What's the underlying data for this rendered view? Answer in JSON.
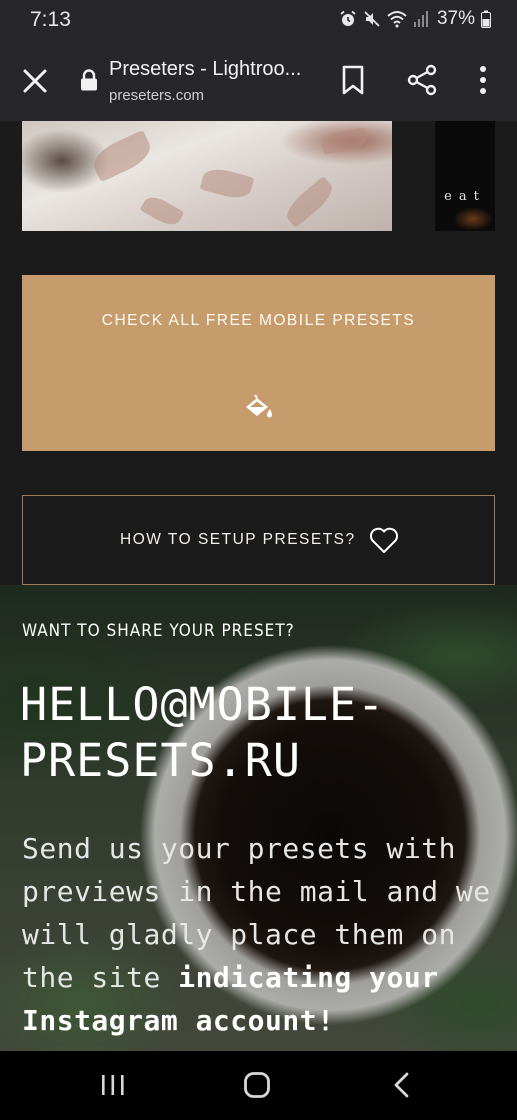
{
  "status_bar": {
    "time": "7:13",
    "battery": "37%",
    "icons": [
      "alarm-icon",
      "mute-icon",
      "wifi-icon",
      "signal-icon",
      "battery-icon"
    ]
  },
  "browser": {
    "title": "Preseters - Lightroo...",
    "domain": "preseters.com",
    "icons": [
      "close-icon",
      "lock-icon",
      "bookmark-icon",
      "share-icon",
      "more-vert-icon"
    ]
  },
  "page": {
    "side_image_text": "eat",
    "free_presets_button": "CHECK ALL FREE MOBILE PRESETS",
    "setup_button": "HOW TO SETUP PRESETS?",
    "share": {
      "kicker": "WANT TO SHARE YOUR PRESET?",
      "email": "HELLO@MOBILE-PRESETS.RU",
      "body_regular": "Send us your presets with previews in the mail and we will gladly place them on the site ",
      "body_bold": "indicating your Instagram account!"
    }
  },
  "nav_bar": {
    "icons": [
      "recent-apps-icon",
      "home-icon",
      "back-icon"
    ]
  },
  "colors": {
    "accent": "#c69c6d",
    "page_bg": "#1b1b1b",
    "chrome_bg": "#27272a",
    "outline": "#9a7a58"
  }
}
